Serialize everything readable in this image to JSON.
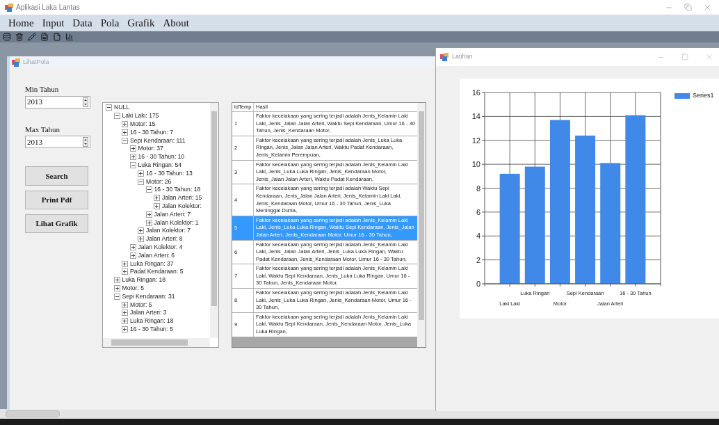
{
  "window": {
    "title": "Aplikasi Laka Lantas"
  },
  "menu": [
    "Home",
    "Input",
    "Data",
    "Pola",
    "Grafik",
    "About"
  ],
  "lihat_pola": {
    "title": "LihatPola",
    "min_label": "Min Tahun",
    "min_value": "2013",
    "max_label": "Max Tahun",
    "max_value": "2013",
    "buttons": [
      "Search",
      "Print Pdf",
      "Lihat Grafik"
    ],
    "tree": [
      {
        "label": "NULL",
        "expanded": true,
        "children": [
          {
            "label": "Laki Laki: 175",
            "expanded": true,
            "children": [
              {
                "label": "Motor: 15",
                "expanded": false
              },
              {
                "label": "16 - 30 Tahun: 7",
                "expanded": false
              },
              {
                "label": "Sepi Kendaraan: 111",
                "expanded": true,
                "children": [
                  {
                    "label": "Motor: 37",
                    "expanded": false
                  },
                  {
                    "label": "16 - 30 Tahun: 10",
                    "expanded": false
                  },
                  {
                    "label": "Luka Ringan: 54",
                    "expanded": true,
                    "children": [
                      {
                        "label": "16 - 30 Tahun: 13",
                        "expanded": false
                      },
                      {
                        "label": "Motor: 26",
                        "expanded": true,
                        "children": [
                          {
                            "label": "16 - 30 Tahun: 18",
                            "expanded": true,
                            "children": [
                              {
                                "label": "Jalan Arteri: 15",
                                "expanded": false
                              },
                              {
                                "label": "Jalan Kolektor:",
                                "expanded": false
                              }
                            ]
                          },
                          {
                            "label": "Jalan Arteri: 7",
                            "expanded": false
                          },
                          {
                            "label": "Jalan Kolektor: 1",
                            "expanded": false
                          }
                        ]
                      },
                      {
                        "label": "Jalan Kolektor: 7",
                        "expanded": false
                      },
                      {
                        "label": "Jalan Arteri: 8",
                        "expanded": false
                      }
                    ]
                  },
                  {
                    "label": "Jalan Kolektor: 4",
                    "expanded": false
                  },
                  {
                    "label": "Jalan Arteri: 6",
                    "expanded": false
                  }
                ]
              },
              {
                "label": "Luka Ringan: 37",
                "expanded": false
              },
              {
                "label": "Padat Kendaraan: 5",
                "expanded": false
              }
            ]
          },
          {
            "label": "Luka Ringan: 18",
            "expanded": false
          },
          {
            "label": "Motor: 5",
            "expanded": false
          },
          {
            "label": "Sepi Kendaraan: 31",
            "expanded": true,
            "children": [
              {
                "label": "Motor: 5",
                "expanded": false
              },
              {
                "label": "Jalan Arteri: 3",
                "expanded": false
              },
              {
                "label": "Luka Ringan: 18",
                "expanded": false
              },
              {
                "label": "16 - 30 Tahun: 5",
                "expanded": false
              }
            ]
          }
        ]
      }
    ],
    "table": {
      "columns": [
        "idTemp",
        "Hasil"
      ],
      "rows": [
        {
          "id": "1",
          "text": "Faktor kecelakaan yang sering terjadi adalah Jenis_Kelamin Laki Laki, Jenis_Jalan Jalan Arteri, Waktu Sepi Kendaraan, Umur 16 - 30 Tahun, Jenis_Kendaraan Motor,",
          "selected": false
        },
        {
          "id": "2",
          "text": "Faktor kecelakaan yang sering terjadi adalah Jenis_Luka Luka Ringan, Jenis_Jalan Jalan Arteri, Waktu Padat Kendaraan, Jenis_Kelamin Perempuan,",
          "selected": false
        },
        {
          "id": "3",
          "text": "Faktor kecelakaan yang sering terjadi adalah Jenis_Kelamin Laki Laki, Jenis_Luka Luka Ringan, Jenis_Kendaraan Motor, Jenis_Jalan Jalan Arteri, Waktu Padat Kendaraan,",
          "selected": false
        },
        {
          "id": "4",
          "text": "Faktor kecelakaan yang sering terjadi adalah Waktu Sepi Kendaraan, Jenis_Jalan Jalan Arteri, Jenis_Kelamin Laki Laki, Jenis_Kendaraan Motor, Umur 16 - 30 Tahun, Jenis_Luka Meninggal Dunia,",
          "selected": false
        },
        {
          "id": "5",
          "text": "Faktor kecelakaan yang sering terjadi adalah Jenis_Kelamin Laki Laki, Jenis_Luka Luka Ringan, Waktu Sepi Kendaraan, Jenis_Jalan Jalan Arteri, Jenis_Kendaraan Motor, Umur 16 - 30 Tahun,",
          "selected": true
        },
        {
          "id": "6",
          "text": "Faktor kecelakaan yang sering terjadi adalah Jenis_Kelamin Laki Laki, Jenis_Jalan Jalan Arteri, Jenis_Luka Luka Ringan, Waktu Padat Kendaraan, Jenis_Kendaraan Motor, Umur 16 - 30 Tahun,",
          "selected": false
        },
        {
          "id": "7",
          "text": "Faktor kecelakaan yang sering terjadi adalah Jenis_Kelamin Laki Laki, Waktu Sepi Kendaraan, Jenis_Luka Luka Ringan, Umur 16 - 30 Tahun, Jenis_Kendaraan Motor,",
          "selected": false
        },
        {
          "id": "8",
          "text": "Faktor kecelakaan yang sering terjadi adalah Jenis_Kelamin Laki Laki, Jenis_Luka Luka Ringan, Jenis_Kendaraan Motor, Umur 16 - 30 Tahun,",
          "selected": false
        },
        {
          "id": "9",
          "text": "Faktor kecelakaan yang sering terjadi adalah Jenis_Kelamin Laki Laki, Waktu Sepi Kendaraan, Jenis_Kendaraan Motor, Jenis_Luka Luka Ringan,",
          "selected": false
        }
      ]
    }
  },
  "latihan": {
    "title": "Latihan",
    "chart_data": {
      "type": "bar",
      "categories": [
        "Laki Laki",
        "Luka Ringan",
        "Motor",
        "Sepi Kendaraan",
        "Jalan Arteri",
        "16 - 30 Tahun"
      ],
      "series": [
        {
          "name": "Series1",
          "color": "#4189e8",
          "values": [
            9.2,
            9.8,
            13.7,
            12.4,
            10.1,
            14.1
          ]
        }
      ],
      "grid": true,
      "ylim": [
        0,
        16
      ],
      "yticks": [
        0,
        2,
        4,
        6,
        8,
        10,
        12,
        14,
        16
      ]
    }
  }
}
